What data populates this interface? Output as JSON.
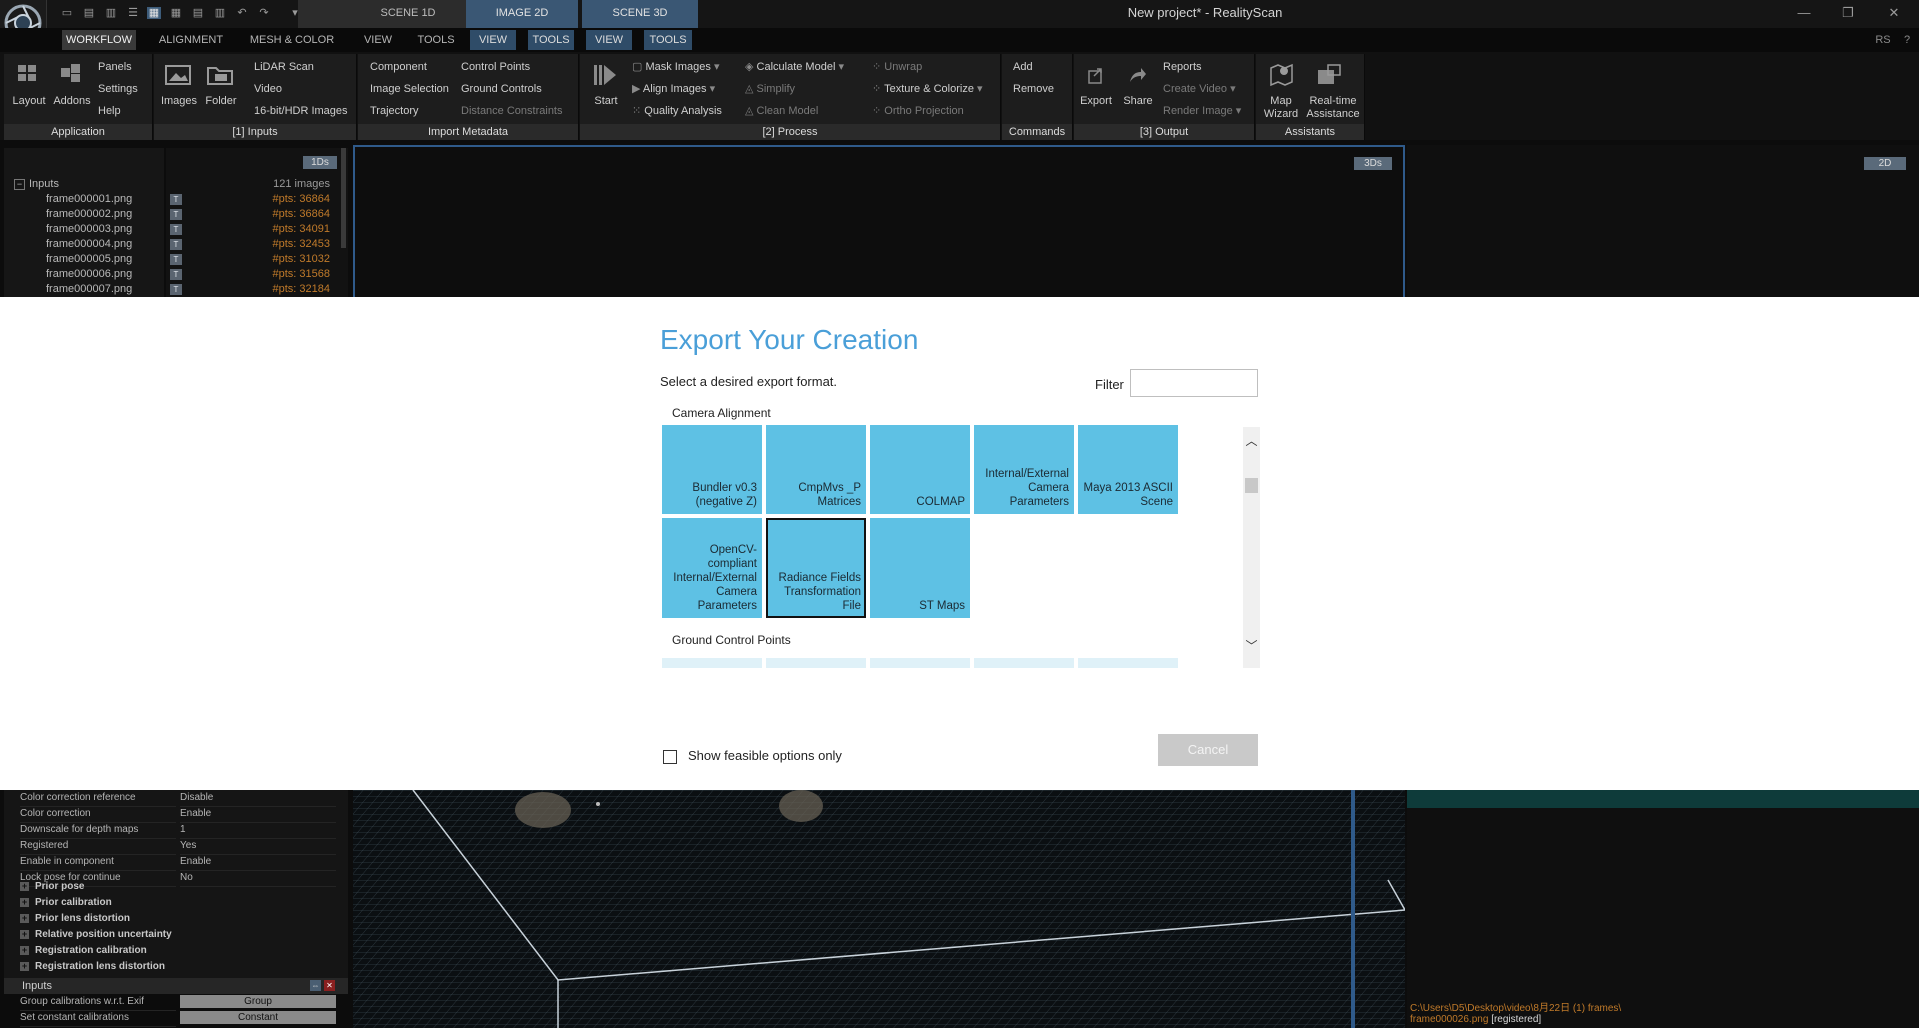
{
  "window": {
    "title": "New project* - RealityScan",
    "minimize": "—",
    "maximize": "❐",
    "close": "✕"
  },
  "scene_tabs": [
    {
      "label": "SCENE 1D"
    },
    {
      "label": "IMAGE 2D"
    },
    {
      "label": "SCENE 3D"
    }
  ],
  "menu": {
    "items": [
      "WORKFLOW",
      "ALIGNMENT",
      "MESH & COLOR",
      "VIEW",
      "TOOLS"
    ],
    "context_items": [
      "VIEW",
      "TOOLS",
      "VIEW",
      "TOOLS"
    ],
    "right_badge": "RS",
    "help": "?"
  },
  "ribbon": {
    "application": {
      "footer": "Application",
      "layout": "Layout",
      "addons": "Addons",
      "panels": "Panels",
      "settings": "Settings",
      "help": "Help"
    },
    "inputs": {
      "footer": "[1] Inputs",
      "images": "Images",
      "folder": "Folder",
      "lidar": "LiDAR Scan",
      "video": "Video",
      "hdr": "16-bit/HDR Images"
    },
    "import_metadata": {
      "footer": "Import Metadata",
      "component": "Component",
      "image_selection": "Image Selection",
      "trajectory": "Trajectory",
      "control_points": "Control Points",
      "ground_controls": "Ground Controls",
      "distance_constraints": "Distance Constraints"
    },
    "process": {
      "footer": "[2] Process",
      "start": "Start",
      "mask_images": "Mask Images",
      "align_images": "Align Images",
      "quality_analysis": "Quality Analysis",
      "calculate_model": "Calculate Model",
      "simplify": "Simplify",
      "clean_model": "Clean Model",
      "unwrap": "Unwrap",
      "texture_colorize": "Texture & Colorize",
      "ortho_projection": "Ortho Projection"
    },
    "commands": {
      "footer": "Commands",
      "add": "Add",
      "remove": "Remove"
    },
    "output": {
      "footer": "[3] Output",
      "export": "Export",
      "share": "Share",
      "reports": "Reports",
      "create_video": "Create Video",
      "render_image": "Render Image"
    },
    "assistants": {
      "footer": "Assistants",
      "map_wizard_1": "Map",
      "map_wizard_2": "Wizard",
      "realtime_1": "Real-time",
      "realtime_2": "Assistance"
    }
  },
  "panel_1ds": {
    "badge": "1Ds",
    "root_label": "Inputs",
    "root_count": "121 images",
    "files": [
      {
        "name": "frame000001.png",
        "pts": "#pts: 36864"
      },
      {
        "name": "frame000002.png",
        "pts": "#pts: 36864"
      },
      {
        "name": "frame000003.png",
        "pts": "#pts: 34091"
      },
      {
        "name": "frame000004.png",
        "pts": "#pts: 32453"
      },
      {
        "name": "frame000005.png",
        "pts": "#pts: 31032"
      },
      {
        "name": "frame000006.png",
        "pts": "#pts: 31568"
      },
      {
        "name": "frame000007.png",
        "pts": "#pts: 32184"
      }
    ],
    "tag": "T"
  },
  "panel_3ds": {
    "badge": "3Ds"
  },
  "panel_2d": {
    "badge": "2D"
  },
  "properties": {
    "rows": [
      {
        "label": "Color correction reference",
        "value": "Disable"
      },
      {
        "label": "Color correction",
        "value": "Enable"
      },
      {
        "label": "Downscale for depth maps",
        "value": "1"
      },
      {
        "label": "Registered",
        "value": "Yes"
      },
      {
        "label": "Enable in component",
        "value": "Enable"
      },
      {
        "label": "Lock pose for continue",
        "value": "No"
      }
    ],
    "sections": [
      "Prior pose",
      "Prior calibration",
      "Prior lens distortion",
      "Relative position uncertainty",
      "Registration calibration",
      "Registration lens distortion"
    ],
    "footer_title": "Inputs",
    "footer_rows": [
      {
        "label": "Group calibrations w.r.t. Exif",
        "value": "Group"
      },
      {
        "label": "Set constant calibrations",
        "value": "Constant"
      }
    ]
  },
  "image_panel": {
    "path": "C:\\Users\\D5\\Desktop\\video\\8月22日 (1) frames\\",
    "file": "frame000026.png",
    "status": "[registered]"
  },
  "export_dialog": {
    "title": "Export Your Creation",
    "subtitle": "Select a desired export format.",
    "filter_label": "Filter",
    "filter_value": "",
    "categories": [
      {
        "name": "Camera Alignment",
        "tiles": [
          {
            "label": "Bundler v0.3 (negative Z)",
            "selected": false
          },
          {
            "label": "CmpMvs _P Matrices",
            "selected": false
          },
          {
            "label": "COLMAP",
            "selected": false
          },
          {
            "label": "Internal/External Camera Parameters",
            "selected": false
          },
          {
            "label": "Maya 2013 ASCII Scene",
            "selected": false
          },
          {
            "label": "OpenCV-compliant Internal/External Camera Parameters",
            "selected": false
          },
          {
            "label": "Radiance Fields Transformation File",
            "selected": true
          },
          {
            "label": "ST Maps",
            "selected": false
          }
        ]
      },
      {
        "name": "Ground Control Points",
        "tiles": []
      }
    ],
    "show_feasible_label": "Show feasible options only",
    "show_feasible_checked": false,
    "cancel_label": "Cancel",
    "scroll_up": "︿",
    "scroll_down": "﹀"
  },
  "colors": {
    "accent_blue": "#4a9fd8",
    "tile_blue": "#5ec1e4",
    "pts_orange": "#c07a2a"
  }
}
